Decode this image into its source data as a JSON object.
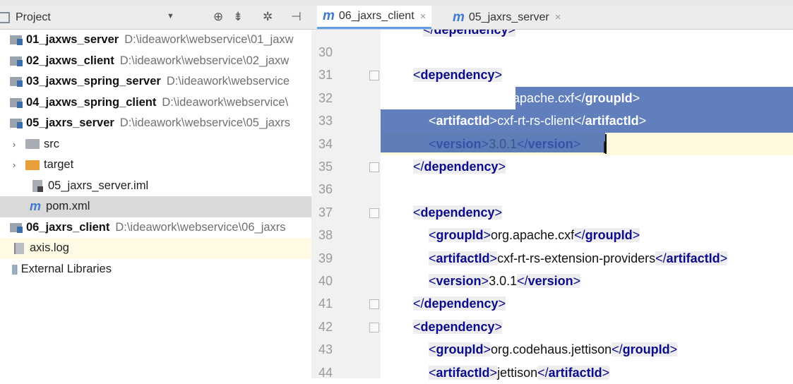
{
  "project_panel": {
    "title": "Project",
    "items": [
      {
        "name": "01_jaxws_server",
        "path": "D:\\ideawork\\webservice\\01_jaxw"
      },
      {
        "name": "02_jaxws_client",
        "path": "D:\\ideawork\\webservice\\02_jaxw"
      },
      {
        "name": "03_jaxws_spring_server",
        "path": "D:\\ideawork\\webservice"
      },
      {
        "name": "04_jaxws_spring_client",
        "path": "D:\\ideawork\\webservice\\"
      },
      {
        "name": "05_jaxrs_server",
        "path": "D:\\ideawork\\webservice\\05_jaxrs"
      },
      {
        "name": "src"
      },
      {
        "name": "target"
      },
      {
        "name": "05_jaxrs_server.iml"
      },
      {
        "name": "pom.xml"
      },
      {
        "name": "06_jaxrs_client",
        "path": "D:\\ideawork\\webservice\\06_jaxrs"
      },
      {
        "name": "axis.log"
      },
      {
        "name": "External Libraries"
      }
    ]
  },
  "editor": {
    "tabs": [
      {
        "label": "06_jaxrs_client",
        "icon": "m"
      },
      {
        "label": "05_jaxrs_server",
        "icon": "m"
      }
    ],
    "lines": [
      {
        "num": "30",
        "text": ""
      },
      {
        "num": "31",
        "text": "<dependency>"
      },
      {
        "num": "32",
        "text": "<groupId>org.apache.cxf</groupId>"
      },
      {
        "num": "33",
        "text": "<artifactId>cxf-rt-rs-client</artifactId>"
      },
      {
        "num": "34",
        "text": "<version>3.0.1</version>"
      },
      {
        "num": "35",
        "text": "</dependency>"
      },
      {
        "num": "36",
        "text": ""
      },
      {
        "num": "37",
        "text": "<dependency>"
      },
      {
        "num": "38",
        "text": "<groupId>org.apache.cxf</groupId>"
      },
      {
        "num": "39",
        "text": "<artifactId>cxf-rt-rs-extension-providers</artifactId>"
      },
      {
        "num": "40",
        "text": "<version>3.0.1</version>"
      },
      {
        "num": "41",
        "text": "</dependency>"
      },
      {
        "num": "42",
        "text": "<dependency>"
      },
      {
        "num": "43",
        "text": "<groupId>org.codehaus.jettison</groupId>"
      },
      {
        "num": "44",
        "text": "<artifactId>jettison</artifactId>"
      }
    ],
    "partial_top": "</dependency>"
  }
}
